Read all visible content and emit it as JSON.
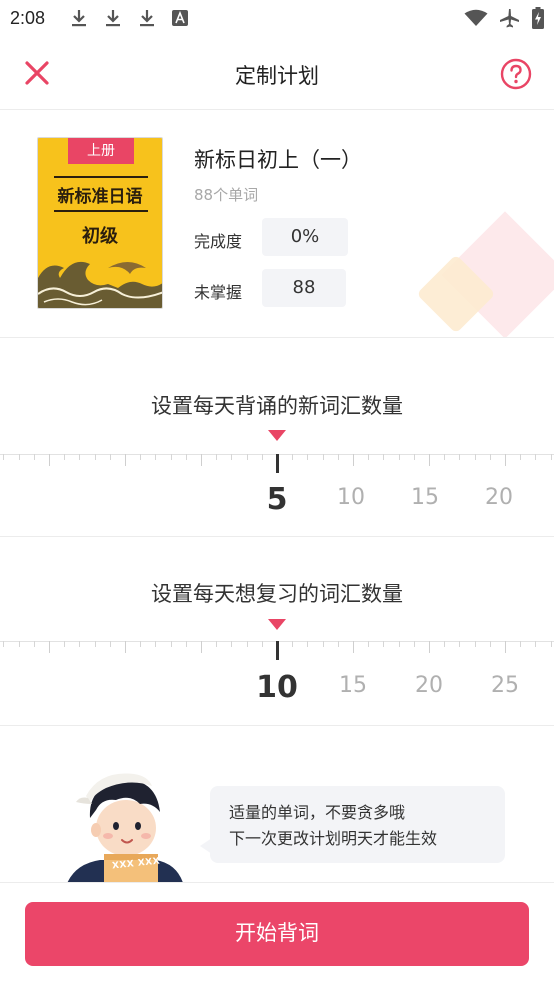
{
  "status_bar": {
    "time": "2:08",
    "icons": [
      "download-icon",
      "download-icon",
      "download-icon",
      "a-box-icon",
      "wifi-icon",
      "airplane-icon",
      "battery-charging-icon"
    ]
  },
  "header": {
    "title": "定制计划",
    "close_icon": "close-icon",
    "help_icon": "help-circle-icon",
    "accent_color": "#e94565"
  },
  "book": {
    "cover": {
      "ribbon": "上册",
      "title": "新标准日语",
      "level": "初级",
      "background_color": "#f7c21c"
    },
    "name": "新标日初上（一）",
    "word_count": "88个单词",
    "stats": [
      {
        "label": "完成度",
        "value": "0%"
      },
      {
        "label": "未掌握",
        "value": "88"
      }
    ]
  },
  "new_words": {
    "title": "设置每天背诵的新词汇数量",
    "selected": "5",
    "options": [
      "10",
      "15",
      "20"
    ]
  },
  "review_words": {
    "title": "设置每天想复习的词汇数量",
    "selected": "10",
    "options": [
      "15",
      "20",
      "25"
    ]
  },
  "tip": {
    "line1": "适量的单词，不要贪多哦",
    "line2": "下一次更改计划明天才能生效",
    "card_text": "XXX XXX"
  },
  "footer": {
    "start_button": "开始背词",
    "button_color": "#eb4669"
  }
}
